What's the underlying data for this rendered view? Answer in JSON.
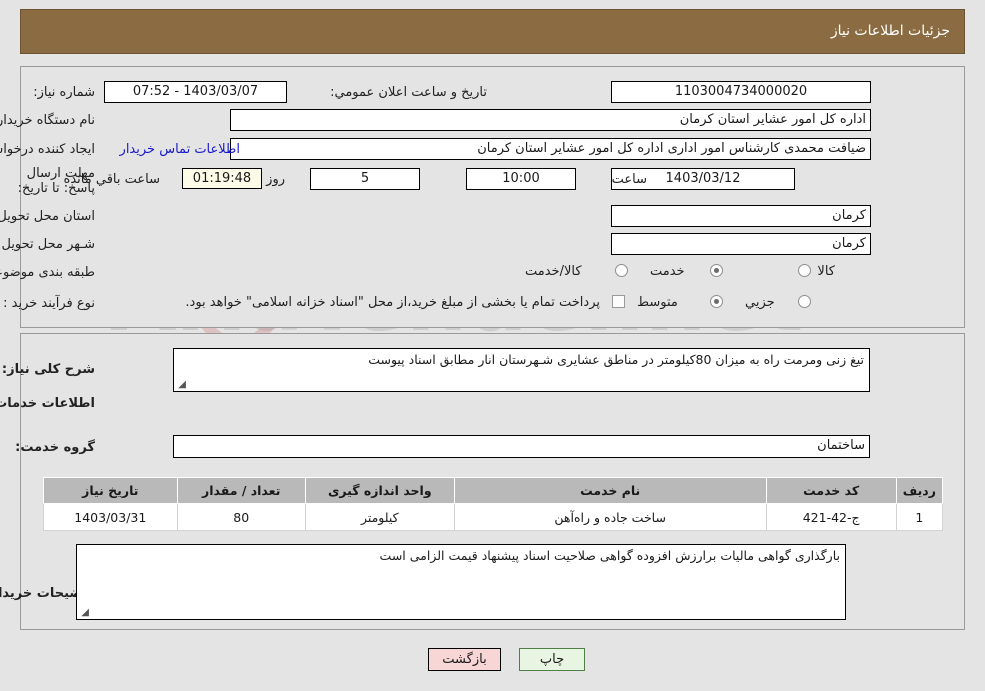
{
  "header": {
    "title": "جزئیات اطلاعات نیاز",
    "bar_color": "#8a6b42"
  },
  "watermark": {
    "text": "AriaTender.net"
  },
  "top_panel": {
    "need_number_label": "شماره نیاز:",
    "need_number_value": "1103004734000020",
    "announce_label": "تاریخ و ساعت اعلان عمومي:",
    "announce_value": "1403/03/07 - 07:52",
    "buyer_org_label": "نام دستگاه خریدار:",
    "buyer_org_value": "اداره کل امور عشایر استان کرمان",
    "creator_label": "ایجاد کننده درخواست:",
    "creator_value": "ضیافت محمدی کارشناس امور اداری اداره کل امور عشایر استان کرمان",
    "contact_link": "اطلاعات تماس خریدار",
    "deadline_label": "مهلت ارسال پاسخ: تا تاریخ:",
    "deadline_date": "1403/03/12",
    "hour_label": "ساعت",
    "deadline_time": "10:00",
    "days_remaining": "5",
    "days_label": "روز و",
    "countdown": "01:19:48",
    "remaining_label": "ساعت باقي مانده",
    "province_label": "استان محل تحویل:",
    "province_value": "کرمان",
    "city_label": "شـهر محل تحویل:",
    "city_value": "کرمان",
    "category_label": "طبقه بندی موضوعی:",
    "category_options": [
      {
        "label": "کالا",
        "selected": false
      },
      {
        "label": "خدمت",
        "selected": true
      },
      {
        "label": "کالا/خدمت",
        "selected": false
      }
    ],
    "process_label": "نوع فرآیند خرید :",
    "process_options": [
      {
        "label": "جزیي",
        "selected": false
      },
      {
        "label": "متوسط",
        "selected": true
      }
    ],
    "treasury_checkbox_label": "پرداخت تمام یا بخشی از مبلغ خرید،از محل \"اسناد خزانه اسلامی\" خواهد بود.",
    "treasury_checked": false
  },
  "mid_panel": {
    "need_desc_label": "شرح کلی نیاز:",
    "need_desc_value": "تیغ زنی ومرمت راه به میزان 80کیلومتر در مناطق عشایری شـهرستان انار مطابق اسناد پیوست",
    "services_section_title": "اطلاعات خدمات مورد نیاز",
    "service_group_label": "گروه خدمت:",
    "service_group_value": "ساختمان",
    "table": {
      "columns": [
        "ردیف",
        "کد خدمت",
        "نام خدمت",
        "واحد اندازه گیری",
        "تعداد / مقدار",
        "تاریخ نیاز"
      ],
      "rows": [
        [
          "1",
          "ج-42-421",
          "ساخت جاده و راه‌آهن",
          "کیلومتر",
          "80",
          "1403/03/31"
        ]
      ]
    },
    "buyer_notes_label": "توضیحات خریدار:",
    "buyer_notes_value": "بارگذاری گواهی مالیات برارزش افزوده گواهی صلاحیت اسناد پیشنهاد قیمت الزامی است"
  },
  "footer": {
    "print_label": "چاپ",
    "back_label": "بازگشت"
  }
}
